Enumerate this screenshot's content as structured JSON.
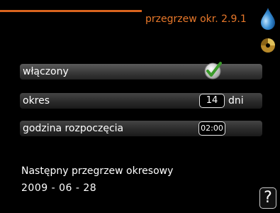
{
  "header": {
    "title": "przegrzew okr. 2.9.1",
    "accent_color": "#e8782a"
  },
  "icons": {
    "top": "water-drop-icon",
    "side": "wheel-icon",
    "check": "checkmark-icon"
  },
  "rows": [
    {
      "label": "włączony",
      "checked": true
    },
    {
      "label": "okres",
      "value": "14",
      "unit": "dni"
    },
    {
      "label": "godzina rozpoczęcia",
      "value": "02:00"
    }
  ],
  "info": {
    "label": "Następny przegrzew okresowy",
    "date": "2009 - 06 - 28"
  },
  "help": {
    "label": "?"
  }
}
